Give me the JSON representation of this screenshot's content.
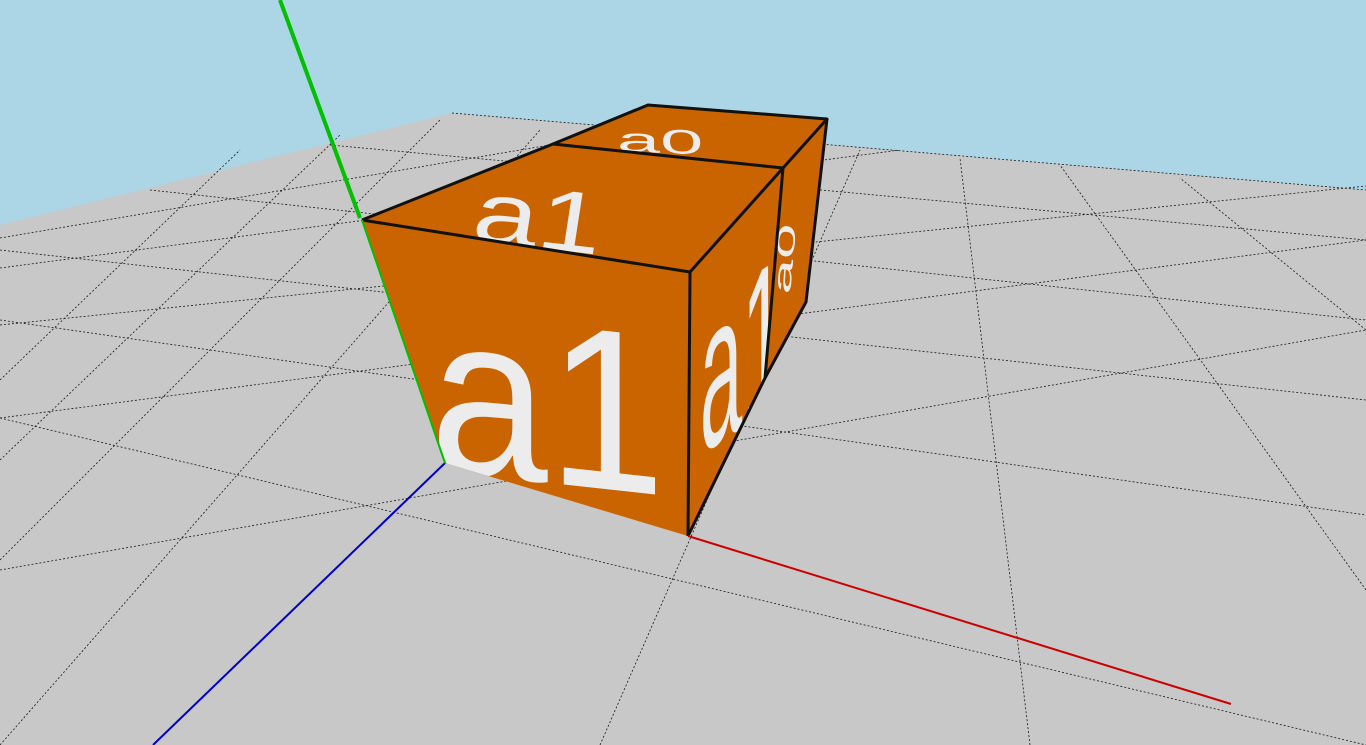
{
  "viewport": {
    "sky_color": "#acd6e6",
    "ground_color": "#c8c8c8",
    "grid_line_color": "#111111",
    "cube_color": "#c96400",
    "cube_edge_color": "#111111",
    "cube_label_color": "#ececec",
    "axes": {
      "x_color": "#cc0000",
      "y_color": "#00c000",
      "z_color": "#0000cc"
    },
    "blocks": [
      {
        "label": "a1"
      },
      {
        "label": "a0"
      }
    ]
  }
}
